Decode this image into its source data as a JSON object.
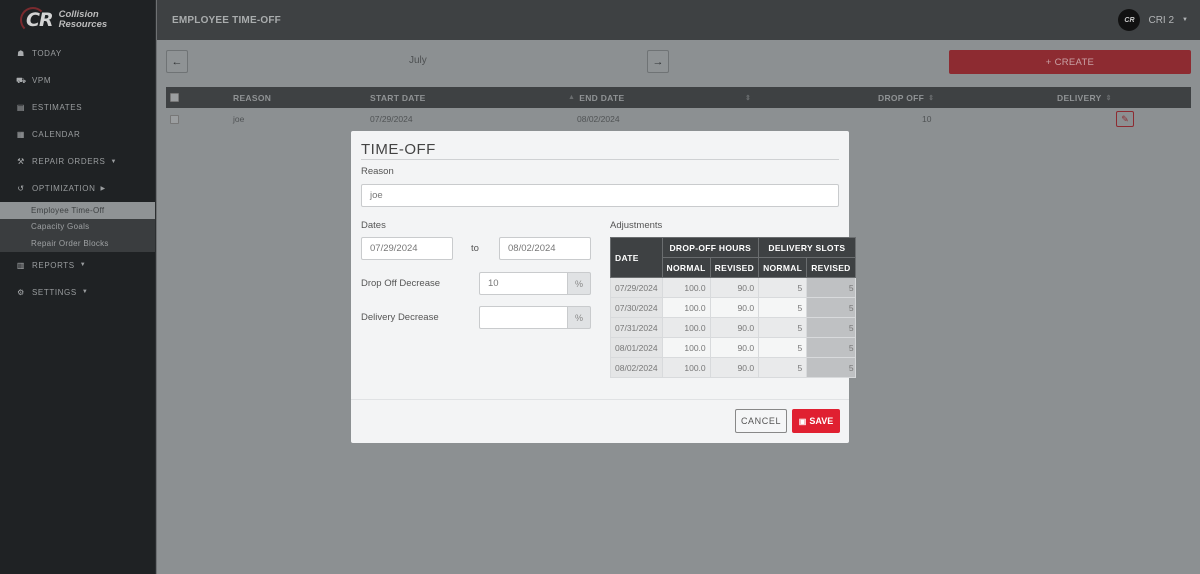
{
  "app": {
    "brand_line1": "Collision",
    "brand_line2": "Resources",
    "brand_mark": "CR"
  },
  "sidebar": {
    "items": [
      {
        "label": "TODAY",
        "icon": "dashboard-icon",
        "glyph": "☗"
      },
      {
        "label": "VPM",
        "icon": "car-icon",
        "glyph": "⛟"
      },
      {
        "label": "ESTIMATES",
        "icon": "id-card-icon",
        "glyph": "▤"
      },
      {
        "label": "CALENDAR",
        "icon": "calendar-icon",
        "glyph": "▦"
      },
      {
        "label": "REPAIR ORDERS",
        "icon": "wrench-icon",
        "glyph": "⚒",
        "caret": "▼"
      },
      {
        "label": "OPTIMIZATION",
        "icon": "history-icon",
        "glyph": "↺",
        "caret": "▶"
      }
    ],
    "sub_items": [
      {
        "label": "Employee Time-Off",
        "active": true
      },
      {
        "label": "Capacity Goals"
      },
      {
        "label": "Repair Order Blocks"
      }
    ],
    "items_after": [
      {
        "label": "REPORTS",
        "icon": "bar-chart-icon",
        "glyph": "▥",
        "caret": "▼"
      },
      {
        "label": "SETTINGS",
        "icon": "gear-icon",
        "glyph": "⚙",
        "caret": "▼"
      }
    ]
  },
  "header": {
    "title": "EMPLOYEE TIME-OFF",
    "user": "CRI 2",
    "avatar_text": "CR",
    "caret": "▼"
  },
  "toolbar": {
    "prev_glyph": "←",
    "next_glyph": "→",
    "month": "July",
    "create_label": "+ CREATE"
  },
  "list": {
    "columns": [
      "REASON",
      "START DATE",
      "END DATE",
      "DROP OFF",
      "DELIVERY"
    ],
    "sort_glyph": "⇕",
    "sorted_glyph": "▲",
    "rows": [
      {
        "reason": "joe",
        "start": "07/29/2024",
        "end": "08/02/2024",
        "drop_off": "10",
        "delivery": ""
      }
    ]
  },
  "modal": {
    "title": "TIME-OFF",
    "reason_label": "Reason",
    "reason_value": "joe",
    "dates_label": "Dates",
    "start_date": "07/29/2024",
    "to_label": "to",
    "end_date": "08/02/2024",
    "drop_off_label": "Drop Off Decrease",
    "drop_off_value": "10",
    "delivery_label": "Delivery Decrease",
    "delivery_value": "",
    "percent": "%",
    "adjustments_label": "Adjustments",
    "table": {
      "h_date": "DATE",
      "h_dropoff": "DROP-OFF HOURS",
      "h_delivery": "DELIVERY SLOTS",
      "h_normal": "NORMAL",
      "h_revised": "REVISED",
      "rows": [
        {
          "date": "07/29/2024",
          "do_normal": "100.0",
          "do_revised": "90.0",
          "dl_normal": "5",
          "dl_revised": "5"
        },
        {
          "date": "07/30/2024",
          "do_normal": "100.0",
          "do_revised": "90.0",
          "dl_normal": "5",
          "dl_revised": "5"
        },
        {
          "date": "07/31/2024",
          "do_normal": "100.0",
          "do_revised": "90.0",
          "dl_normal": "5",
          "dl_revised": "5"
        },
        {
          "date": "08/01/2024",
          "do_normal": "100.0",
          "do_revised": "90.0",
          "dl_normal": "5",
          "dl_revised": "5"
        },
        {
          "date": "08/02/2024",
          "do_normal": "100.0",
          "do_revised": "90.0",
          "dl_normal": "5",
          "dl_revised": "5"
        }
      ]
    },
    "cancel_label": "CANCEL",
    "save_label": "SAVE",
    "save_glyph": "🖫"
  },
  "colors": {
    "accent_red": "#e02031",
    "create_red": "#8d2b31",
    "header_dark": "#3e4143"
  }
}
